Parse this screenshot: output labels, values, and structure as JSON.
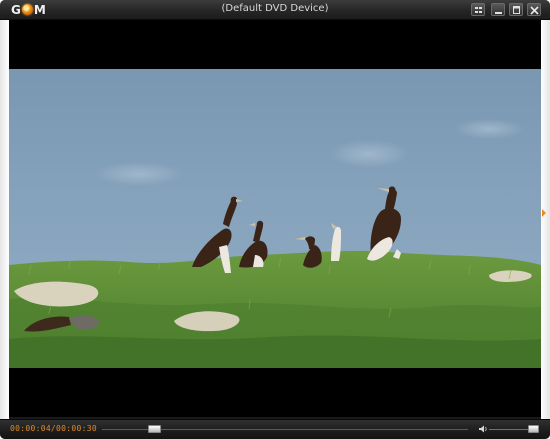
{
  "app": {
    "logo_text": "GOM",
    "title": "(Default DVD Device)"
  },
  "titlebar_buttons": [
    {
      "name": "playlist",
      "icon": "playlist-icon"
    },
    {
      "name": "minimize",
      "icon": "minimize-icon"
    },
    {
      "name": "maximize",
      "icon": "maximize-icon"
    },
    {
      "name": "close",
      "icon": "close-icon"
    }
  ],
  "video": {
    "scene": "seabirds on a grassy island under a pale blue sky",
    "colors": {
      "sky": "#7f9bb5",
      "grass": "#5c8a36",
      "letterbox": "#000000"
    }
  },
  "playback": {
    "time_display": "00:00:04/00:00:30",
    "progress": 0.14,
    "volume": 0.86
  },
  "colors": {
    "accent": "#e28a2a",
    "frame": "#1a1a1a"
  }
}
